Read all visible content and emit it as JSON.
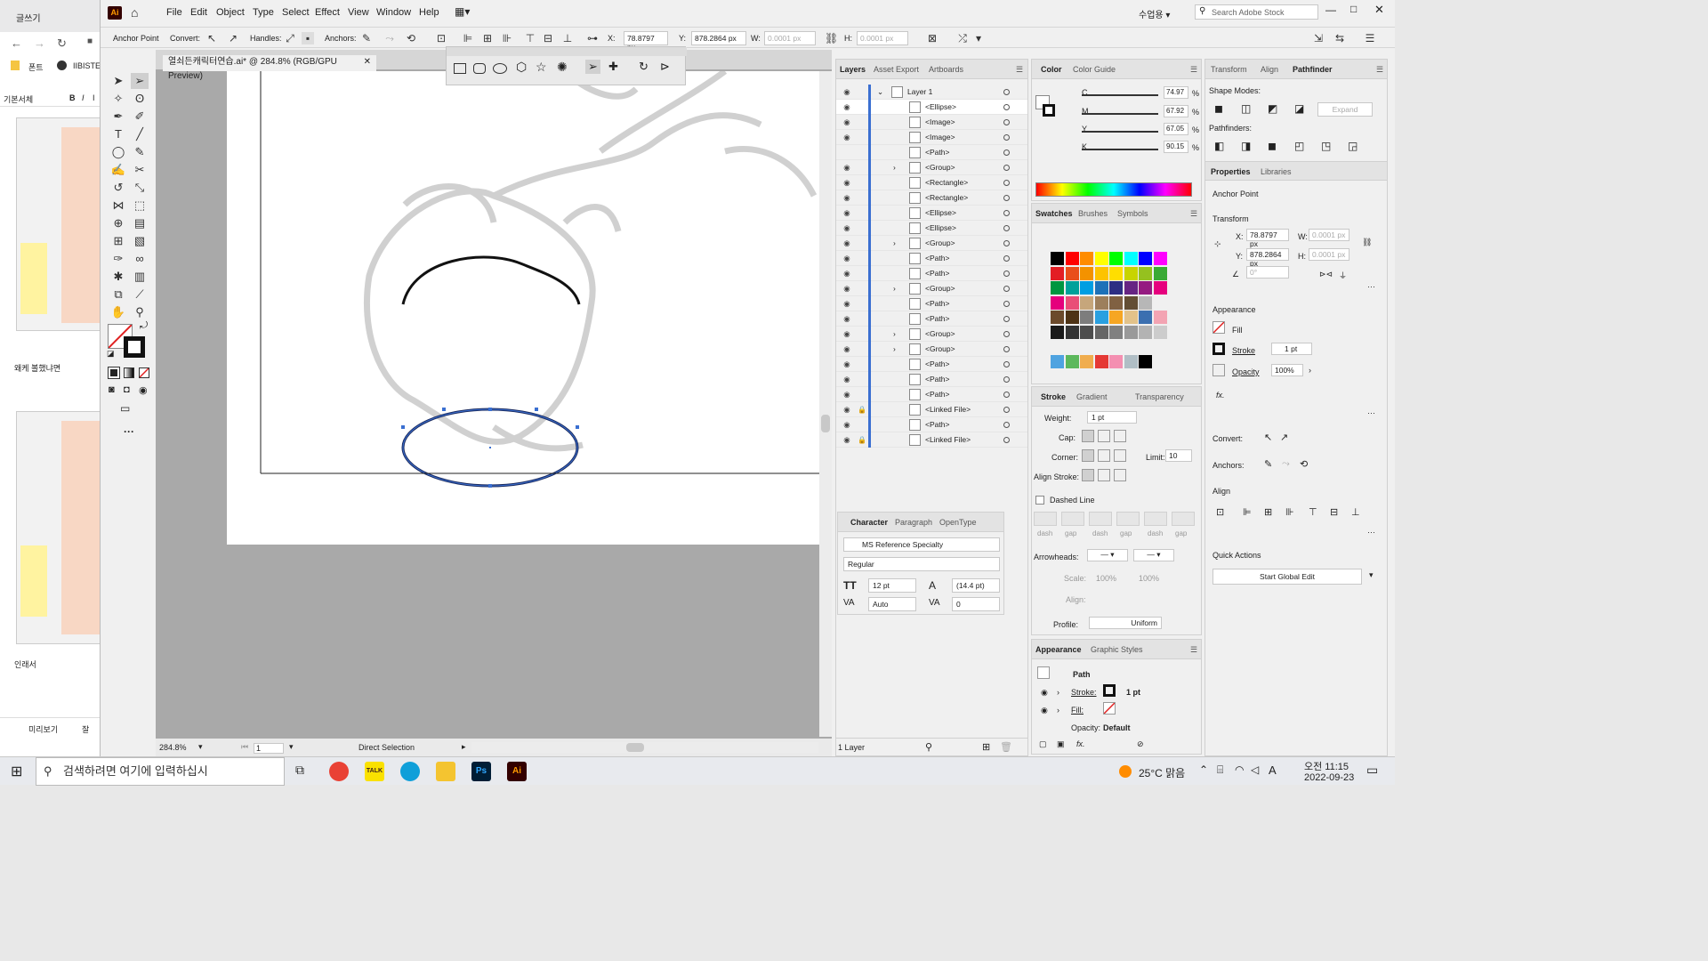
{
  "browser": {
    "tab_title": "글쓰기",
    "bookmarks": [
      "폰트",
      "IIBISTE"
    ],
    "toolbar": [
      "기본서체",
      "B",
      "I",
      "I"
    ],
    "caption1": "왜케 볼했냐면",
    "caption2": "인래서",
    "preview_label": "미리보기",
    "preview_label2": "잘"
  },
  "app": {
    "logo": "Ai",
    "menu": [
      "File",
      "Edit",
      "Object",
      "Type",
      "Select",
      "Effect",
      "View",
      "Window",
      "Help"
    ],
    "workspace": "수업용",
    "search_placeholder": "Search Adobe Stock"
  },
  "control_bar": {
    "mode": "Anchor Point",
    "convert": "Convert:",
    "handles": "Handles:",
    "anchors": "Anchors:",
    "x_label": "X:",
    "x_value": "78.8797 px",
    "y_label": "Y:",
    "y_value": "878.2864 px",
    "w_label": "W:",
    "w_value": "0.0001 px",
    "h_label": "H:",
    "h_value": "0.0001 px"
  },
  "document": {
    "tab_title": "열쇠든캐릭터연습.ai* @ 284.8% (RGB/GPU Preview)",
    "zoom": "284.8%",
    "artboard": "1",
    "tool": "Direct Selection"
  },
  "layers_panel": {
    "tabs": [
      "Layers",
      "Asset Export",
      "Artboards"
    ],
    "layer": "Layer 1",
    "rows": [
      "<Ellipse>",
      "<Image>",
      "<Image>",
      "<Path>",
      "<Group>",
      "<Rectangle>",
      "<Rectangle>",
      "<Ellipse>",
      "<Ellipse>",
      "<Group>",
      "<Path>",
      "<Path>",
      "<Group>",
      "<Path>",
      "<Path>",
      "<Group>",
      "<Group>",
      "<Path>",
      "<Path>",
      "<Path>",
      "<Linked File>",
      "<Path>",
      "<Linked File>"
    ],
    "footer": "1 Layer"
  },
  "color_panel": {
    "tabs": [
      "Color",
      "Color Guide"
    ],
    "c_label": "C",
    "c": "74.97",
    "m_label": "M",
    "m": "67.92",
    "y_label": "Y",
    "y": "67.05",
    "k_label": "K",
    "k": "90.15",
    "pct": "%"
  },
  "swatches_panel": {
    "tabs": [
      "Swatches",
      "Brushes",
      "Symbols"
    ]
  },
  "stroke_panel": {
    "tabs": [
      "Stroke",
      "Gradient",
      "Transparency"
    ],
    "weight_label": "Weight:",
    "weight": "1 pt",
    "cap_label": "Cap:",
    "corner_label": "Corner:",
    "limit_label": "Limit:",
    "limit": "10",
    "align_label": "Align Stroke:",
    "dashed_label": "Dashed Line",
    "dash_labels": [
      "dash",
      "gap",
      "dash",
      "gap",
      "dash",
      "gap"
    ],
    "arrowheads_label": "Arrowheads:",
    "scale_label": "Scale:",
    "scale1": "100%",
    "scale2": "100%",
    "align2_label": "Align:",
    "profile_label": "Profile:",
    "profile": "Uniform"
  },
  "character_panel": {
    "tabs": [
      "Character",
      "Paragraph",
      "OpenType"
    ],
    "font": "MS Reference Specialty",
    "style": "Regular",
    "size": "12 pt",
    "leading": "(14.4 pt)",
    "kerning": "Auto",
    "tracking": "0"
  },
  "appearance_panel": {
    "tabs": [
      "Appearance",
      "Graphic Styles"
    ],
    "path": "Path",
    "stroke_label": "Stroke:",
    "stroke_value": "1 pt",
    "fill_label": "Fill:",
    "opacity_label": "Opacity:",
    "opacity_value": "Default"
  },
  "right_panel": {
    "tabs": [
      "Transform",
      "Align",
      "Pathfinder"
    ],
    "shape_modes": "Shape Modes:",
    "expand": "Expand",
    "pathfinders": "Pathfinders:",
    "prop_tabs": [
      "Properties",
      "Libraries"
    ],
    "anchor_point": "Anchor Point",
    "transform": "Transform",
    "x_label": "X:",
    "x": "78.8797 px",
    "y_label": "Y:",
    "y": "878.2864 px",
    "w_label": "W:",
    "w": "0.0001 px",
    "h_label": "H:",
    "h": "0.0001 px",
    "angle": "0°",
    "appearance": "Appearance",
    "fill": "Fill",
    "stroke": "Stroke",
    "stroke_value": "1 pt",
    "opacity": "Opacity",
    "opacity_value": "100%",
    "fx": "fx.",
    "convert": "Convert:",
    "anchors": "Anchors:",
    "align": "Align",
    "quick_actions": "Quick Actions",
    "start_global_edit": "Start Global Edit"
  },
  "taskbar": {
    "search": "검색하려면 여기에 입력하십시",
    "weather": "25°C 맑음",
    "ime": "A",
    "time": "오전 11:15",
    "date": "2022-09-23",
    "apps": [
      "Chrome",
      "TALK",
      "Edge",
      "Explorer",
      "Ps",
      "Ai"
    ]
  },
  "colors": {
    "accent": "#3a6fd1",
    "ai_orange": "#ff9a00",
    "ai_dark": "#330000",
    "ellipse_stroke": "#1a2a5e"
  }
}
